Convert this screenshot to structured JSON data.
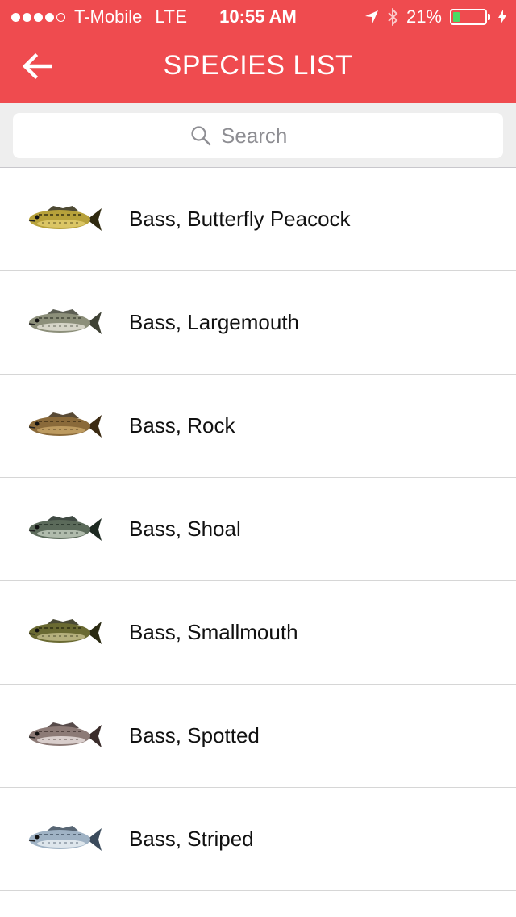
{
  "status_bar": {
    "carrier": "T-Mobile",
    "network": "LTE",
    "time": "10:55 AM",
    "battery": "21%",
    "battery_level": 0.21,
    "signal_bars": 4,
    "signal_total": 5
  },
  "nav": {
    "title": "SPECIES LIST"
  },
  "search": {
    "placeholder": "Search",
    "value": ""
  },
  "species": [
    {
      "label": "Bass, Butterfly Peacock",
      "icon": "fish-butterfly-peacock-bass-icon",
      "body": "#b7a13a",
      "spot": "#2f2a10",
      "belly": "#e4d070"
    },
    {
      "label": "Bass, Largemouth",
      "icon": "fish-largemouth-bass-icon",
      "body": "#8c8f7a",
      "spot": "#3f4235",
      "belly": "#e8e6dc"
    },
    {
      "label": "Bass, Rock",
      "icon": "fish-rock-bass-icon",
      "body": "#8a6a3a",
      "spot": "#3b2a12",
      "belly": "#c9a76a"
    },
    {
      "label": "Bass, Shoal",
      "icon": "fish-shoal-bass-icon",
      "body": "#5b6a5a",
      "spot": "#1e2a22",
      "belly": "#c6cfc0"
    },
    {
      "label": "Bass, Smallmouth",
      "icon": "fish-smallmouth-bass-icon",
      "body": "#6a6a32",
      "spot": "#2a2a12",
      "belly": "#c8c290"
    },
    {
      "label": "Bass, Spotted",
      "icon": "fish-spotted-bass-icon",
      "body": "#8c7a76",
      "spot": "#3a2c2a",
      "belly": "#ece4e2"
    },
    {
      "label": "Bass, Striped",
      "icon": "fish-striped-bass-icon",
      "body": "#9fb2c4",
      "spot": "#3b4b5c",
      "belly": "#eef2f6"
    }
  ],
  "colors": {
    "header": "#ef4b4f",
    "battery_fill": "#4cd964"
  }
}
